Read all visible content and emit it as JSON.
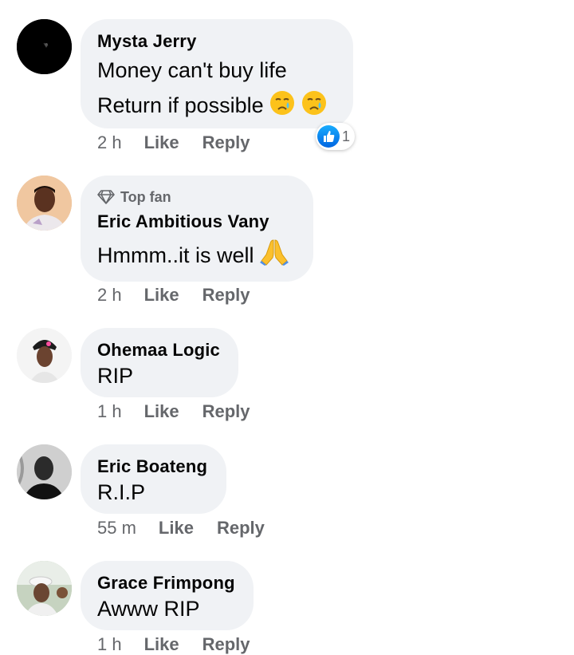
{
  "comments": [
    {
      "author": "Mysta Jerry",
      "lines": [
        "Money can't buy life",
        "Return if possible"
      ],
      "time": "2 h",
      "like_label": "Like",
      "reply_label": "Reply",
      "reaction_count": "1",
      "avatar_icon": "dark-avatar"
    },
    {
      "badge": "Top fan",
      "badge_icon": "diamond-icon",
      "author": "Eric Ambitious Vany",
      "text": "Hmmm..it is well",
      "time": "2 h",
      "like_label": "Like",
      "reply_label": "Reply"
    },
    {
      "author": "Ohemaa Logic",
      "text": "RIP",
      "time": "1 h",
      "like_label": "Like",
      "reply_label": "Reply"
    },
    {
      "author": "Eric Boateng",
      "text": "R.I.P",
      "time": "55 m",
      "like_label": "Like",
      "reply_label": "Reply"
    },
    {
      "author": "Grace Frimpong",
      "text": "Awww RIP",
      "time": "1 h",
      "like_label": "Like",
      "reply_label": "Reply"
    }
  ],
  "colors": {
    "bubble_bg": "#f0f2f5",
    "meta_text": "#65676b",
    "like_blue": "#0a7cff"
  }
}
